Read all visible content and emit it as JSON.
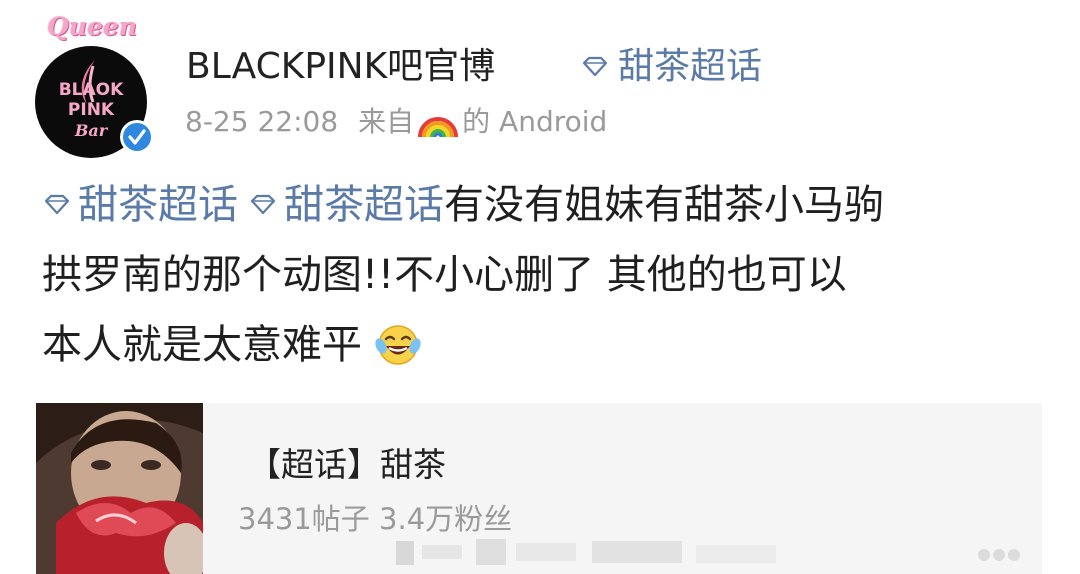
{
  "post": {
    "avatar": {
      "crown_text": "Queen",
      "logo_lines": [
        "BLAOK",
        "PINK",
        "Bar"
      ]
    },
    "username": "BLACKPINK吧官博",
    "header_topic": "甜茶超话",
    "date": "8-25 22:08",
    "source_prefix": "来自",
    "source_suffix": "的 Android",
    "body": {
      "tag1": "甜茶超话",
      "tag2": "甜茶超话",
      "line1_text": "有没有姐妹有甜茶小马驹",
      "line2_text": "拱罗南的那个动图!!不小心删了 其他的也可以",
      "line3_text": "本人就是太意难平"
    }
  },
  "card": {
    "title": "【超话】甜茶",
    "stats": "3431帖子 3.4万粉丝"
  },
  "colors": {
    "link_blue": "#5a7aa8",
    "text_dark": "#222222",
    "text_gray": "#9a9a9a",
    "card_bg": "#f5f5f5",
    "verified_blue": "#2f88e0"
  },
  "icons": {
    "verified": "verified-badge-icon",
    "topic": "diamond-icon",
    "rainbow": "rainbow-emoji-icon",
    "laugh": "laughing-crying-emoji-icon"
  }
}
